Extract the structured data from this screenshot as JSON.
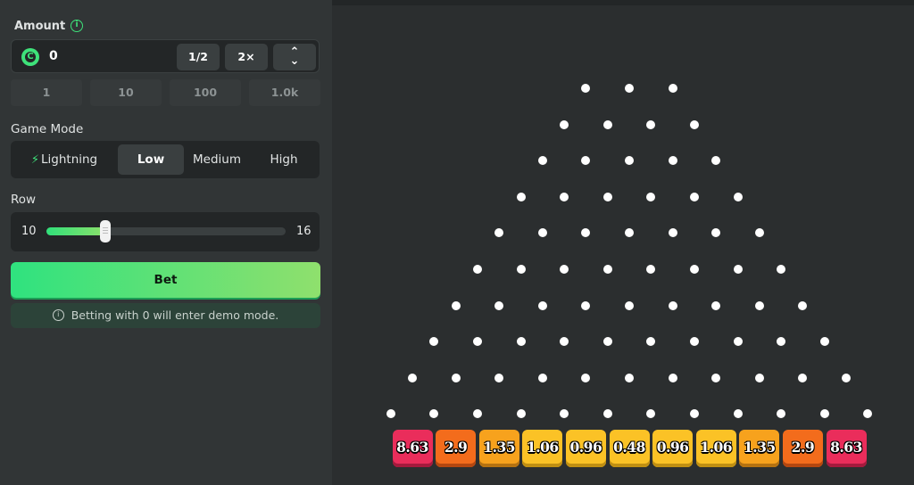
{
  "amount": {
    "label": "Amount",
    "info_icon": "i",
    "coin_symbol": "C",
    "value": "0",
    "half_label": "1/2",
    "double_label": "2×",
    "up_arrow": "⌃",
    "down_arrow": "⌄",
    "chips": [
      "1",
      "10",
      "100",
      "1.0k"
    ]
  },
  "game_mode": {
    "label": "Game Mode",
    "lightning_icon": "⚡",
    "modes": [
      "Lightning",
      "Low",
      "Medium",
      "High"
    ],
    "selected": "Low"
  },
  "row": {
    "label": "Row",
    "min": "10",
    "max": "16",
    "value": 10
  },
  "bet": {
    "label": "Bet",
    "demo_note": "Betting with 0 will enter demo mode.",
    "info_icon": "i"
  },
  "board": {
    "multipliers": [
      "8.63",
      "2.9",
      "1.35",
      "1.06",
      "0.96",
      "0.48",
      "0.96",
      "1.06",
      "1.35",
      "2.9",
      "8.63"
    ],
    "multiplier_colors": [
      "red",
      "orange",
      "amber",
      "yellow",
      "yellow",
      "yellow",
      "yellow",
      "yellow",
      "amber",
      "orange",
      "red"
    ]
  },
  "colors": {
    "accent_green": "#3ee27a",
    "panel": "#313536",
    "board_bg": "#2b2e2f"
  }
}
